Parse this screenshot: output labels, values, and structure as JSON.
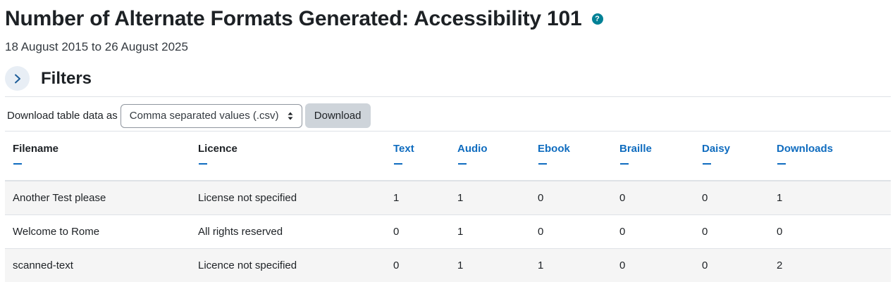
{
  "page": {
    "title": "Number of Alternate Formats Generated: Accessibility 101",
    "help_glyph": "?",
    "date_range": "18 August 2015 to 26 August 2025"
  },
  "filters": {
    "heading": "Filters",
    "collapsed": true
  },
  "download": {
    "label": "Download table data as",
    "selected_format": "Comma separated values (.csv)",
    "button_label": "Download"
  },
  "table": {
    "columns": [
      "Filename",
      "Licence",
      "Text",
      "Audio",
      "Ebook",
      "Braille",
      "Daisy",
      "Downloads"
    ],
    "sortable_columns": [
      "Text",
      "Audio",
      "Ebook",
      "Braille",
      "Daisy",
      "Downloads"
    ],
    "rows": [
      [
        "Another Test please",
        "License not specified",
        "1",
        "1",
        "0",
        "0",
        "0",
        "1"
      ],
      [
        "Welcome to Rome",
        "All rights reserved",
        "0",
        "1",
        "0",
        "0",
        "0",
        "0"
      ],
      [
        "scanned-text",
        "Licence not specified",
        "0",
        "1",
        "1",
        "0",
        "0",
        "2"
      ]
    ]
  },
  "colors": {
    "link": "#0f6cbf",
    "help_icon": "#008196",
    "stripe": "#f5f5f5",
    "button_bg": "#ced4da"
  }
}
